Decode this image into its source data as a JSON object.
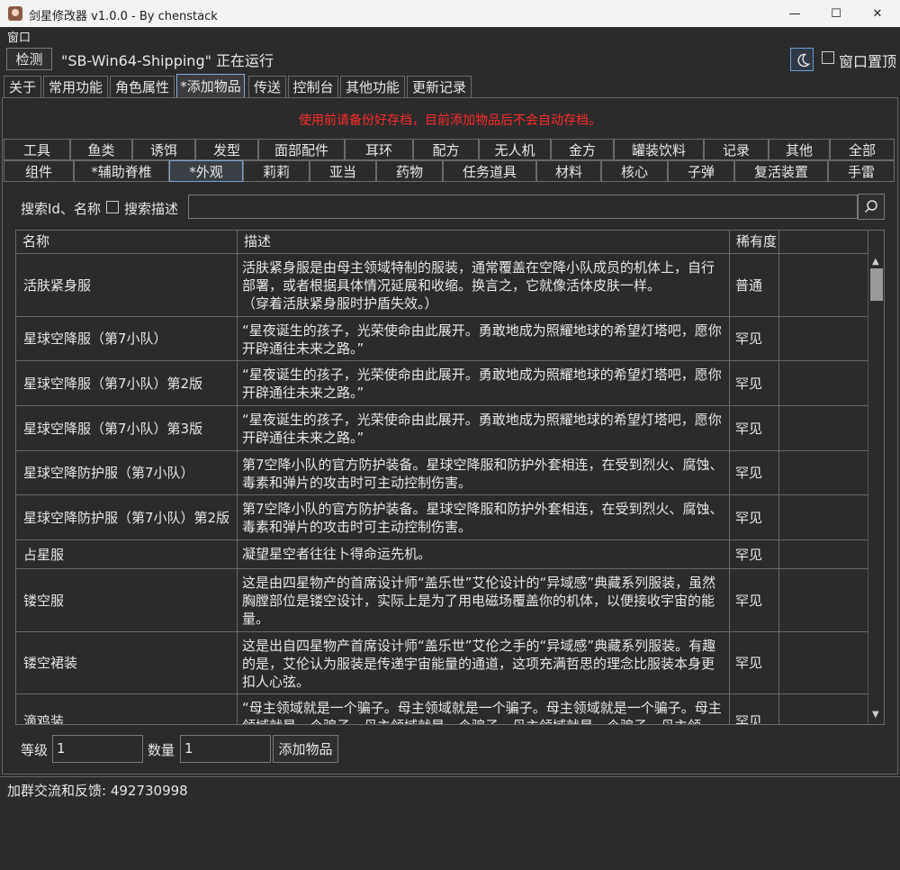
{
  "window": {
    "title": "剑星修改器 v1.0.0 - By chenstack",
    "minimize": "—",
    "maximize": "☐",
    "close": "✕"
  },
  "menu": {
    "window_label": "窗口"
  },
  "detect": {
    "button_label": "检测",
    "status_text": "\"SB-Win64-Shipping\" 正在运行"
  },
  "topbar": {
    "pin_label": "窗口置顶",
    "pin_checked": false
  },
  "main_tabs": [
    {
      "label": "关于"
    },
    {
      "label": "常用功能"
    },
    {
      "label": "角色属性"
    },
    {
      "label": "*添加物品",
      "active": true
    },
    {
      "label": "传送"
    },
    {
      "label": "控制台"
    },
    {
      "label": "其他功能"
    },
    {
      "label": "更新记录"
    }
  ],
  "warning": "使用前请备份好存档，目前添加物品后不会自动存档。",
  "category_rows": [
    [
      {
        "label": "工具"
      },
      {
        "label": "鱼类"
      },
      {
        "label": "诱饵"
      },
      {
        "label": "发型"
      },
      {
        "label": "面部配件"
      },
      {
        "label": "耳环"
      },
      {
        "label": "配方"
      },
      {
        "label": "无人机"
      },
      {
        "label": "金方"
      },
      {
        "label": "罐装饮料"
      },
      {
        "label": "记录"
      },
      {
        "label": "其他"
      },
      {
        "label": "全部"
      }
    ],
    [
      {
        "label": "组件"
      },
      {
        "label": "*辅助脊椎"
      },
      {
        "label": "*外观",
        "active": true
      },
      {
        "label": "莉莉"
      },
      {
        "label": "亚当"
      },
      {
        "label": "药物"
      },
      {
        "label": "任务道具"
      },
      {
        "label": "材料"
      },
      {
        "label": "核心"
      },
      {
        "label": "子弹"
      },
      {
        "label": "复活装置"
      },
      {
        "label": "手雷"
      }
    ]
  ],
  "search": {
    "label": "搜索Id、名称",
    "desc_label": "搜索描述",
    "desc_checked": false,
    "value": "",
    "placeholder": ""
  },
  "table": {
    "columns": [
      "名称",
      "描述",
      "稀有度"
    ],
    "rows": [
      {
        "name": "活肤紧身服",
        "desc": "活肤紧身服是由母主领域特制的服装，通常覆盖在空降小队成员的机体上，自行部署，或者根据具体情况延展和收缩。换言之，它就像活体皮肤一样。\n（穿着活肤紧身服时护盾失效。）",
        "rarity": "普通"
      },
      {
        "name": "星球空降服（第7小队）",
        "desc": "“星夜诞生的孩子，光荣使命由此展开。勇敢地成为照耀地球的希望灯塔吧，愿你开辟通往未来之路。”",
        "rarity": "罕见"
      },
      {
        "name": "星球空降服（第7小队）第2版",
        "desc": "“星夜诞生的孩子，光荣使命由此展开。勇敢地成为照耀地球的希望灯塔吧，愿你开辟通往未来之路。”",
        "rarity": "罕见"
      },
      {
        "name": "星球空降服（第7小队）第3版",
        "desc": "“星夜诞生的孩子，光荣使命由此展开。勇敢地成为照耀地球的希望灯塔吧，愿你开辟通往未来之路。”",
        "rarity": "罕见"
      },
      {
        "name": "星球空降防护服（第7小队）",
        "desc": "第7空降小队的官方防护装备。星球空降服和防护外套相连，在受到烈火、腐蚀、毒素和弹片的攻击时可主动控制伤害。",
        "rarity": "罕见"
      },
      {
        "name": "星球空降防护服（第7小队）第2版",
        "desc": "第7空降小队的官方防护装备。星球空降服和防护外套相连，在受到烈火、腐蚀、毒素和弹片的攻击时可主动控制伤害。",
        "rarity": "罕见"
      },
      {
        "name": "占星服",
        "desc": "凝望星空者往往卜得命运先机。",
        "rarity": "罕见"
      },
      {
        "name": "镂空服",
        "desc": "这是由四星物产的首席设计师“盖乐世”艾伦设计的“异域感”典藏系列服装，虽然胸膛部位是镂空设计，实际上是为了用电磁场覆盖你的机体，以便接收宇宙的能量。",
        "rarity": "罕见"
      },
      {
        "name": "镂空裙装",
        "desc": "这是出自四星物产首席设计师“盖乐世”艾伦之手的“异域感”典藏系列服装。有趣的是，艾伦认为服装是传递宇宙能量的通道，这项充满哲思的理念比服装本身更扣人心弦。",
        "rarity": "罕见"
      },
      {
        "name": "滴鸡装",
        "desc": "“母主领域就是一个骗子。母主领域就是一个骗子。母主领域就是一个骗子。母主领域就是一个骗子。母主领域就是一个骗子。母主领域就是一个骗子。母主领",
        "rarity": "罕见"
      }
    ]
  },
  "bottom": {
    "level_label": "等级",
    "level_value": "1",
    "qty_label": "数量",
    "qty_value": "1",
    "add_button": "添加物品"
  },
  "footer": {
    "text": "加群交流和反馈: 492730998"
  },
  "colors": {
    "warning": "#ff2a2a",
    "background": "#2b2b2b",
    "active_tab_border": "#86aee0"
  }
}
